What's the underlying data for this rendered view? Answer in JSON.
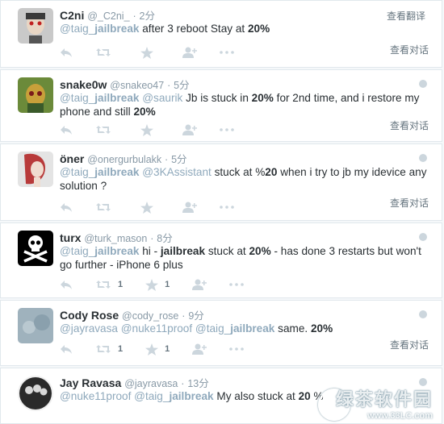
{
  "tweets": [
    {
      "name": "C2ni",
      "handle": "@_C2ni_",
      "sep": "·",
      "time": "2分",
      "translate": "查看翻译",
      "body": [
        {
          "t": "@taig_",
          "c": "mention"
        },
        {
          "t": "jailbreak",
          "c": "mention-b"
        },
        {
          "t": " after 3 reboot Stay at ",
          "c": ""
        },
        {
          "t": "20%",
          "c": "hl"
        }
      ],
      "retweets": "",
      "likes": "",
      "convo": "查看对话"
    },
    {
      "name": "snake0w",
      "handle": "@snakeo47",
      "sep": "·",
      "time": "5分",
      "body": [
        {
          "t": "@taig_",
          "c": "mention"
        },
        {
          "t": "jailbreak",
          "c": "mention-b"
        },
        {
          "t": " @saurik",
          "c": "mention"
        },
        {
          "t": " Jb is stuck in ",
          "c": ""
        },
        {
          "t": "20%",
          "c": "hl"
        },
        {
          "t": " for 2nd time, and i restore my phone and still ",
          "c": ""
        },
        {
          "t": "20%",
          "c": "hl"
        }
      ],
      "retweets": "",
      "likes": "",
      "convo": "查看对话"
    },
    {
      "name": "öner",
      "handle": "@onergurbulakk",
      "sep": "·",
      "time": "5分",
      "body": [
        {
          "t": "@taig_",
          "c": "mention"
        },
        {
          "t": "jailbreak",
          "c": "mention-b"
        },
        {
          "t": " @3KAssistant",
          "c": "mention"
        },
        {
          "t": " stuck at %",
          "c": ""
        },
        {
          "t": "20",
          "c": "hl"
        },
        {
          "t": " when i try to jb my idevice any solution ?",
          "c": ""
        }
      ],
      "retweets": "",
      "likes": "",
      "convo": "查看对话"
    },
    {
      "name": "turx",
      "handle": "@turk_mason",
      "sep": "·",
      "time": "8分",
      "body": [
        {
          "t": "@taig_",
          "c": "mention"
        },
        {
          "t": "jailbreak",
          "c": "mention-b"
        },
        {
          "t": " hi - ",
          "c": ""
        },
        {
          "t": "jailbreak",
          "c": "hl"
        },
        {
          "t": " stuck at ",
          "c": ""
        },
        {
          "t": "20%",
          "c": "hl"
        },
        {
          "t": " - has done 3 restarts but won't go further - iPhone 6 plus",
          "c": ""
        }
      ],
      "retweets": "1",
      "likes": "1",
      "convo": ""
    },
    {
      "name": "Cody Rose",
      "handle": "@cody_rose",
      "sep": "·",
      "time": "9分",
      "body": [
        {
          "t": "@jayravasa",
          "c": "mention"
        },
        {
          "t": " @nuke11proof",
          "c": "mention"
        },
        {
          "t": " @taig_",
          "c": "mention"
        },
        {
          "t": "jailbreak",
          "c": "mention-b"
        },
        {
          "t": " same. ",
          "c": ""
        },
        {
          "t": "20%",
          "c": "hl"
        }
      ],
      "retweets": "1",
      "likes": "1",
      "convo": "查看对话"
    },
    {
      "name": "Jay Ravasa",
      "handle": "@jayravasa",
      "sep": "·",
      "time": "13分",
      "body": [
        {
          "t": "@nuke11proof",
          "c": "mention"
        },
        {
          "t": " @taig_",
          "c": "mention"
        },
        {
          "t": "jailbreak",
          "c": "mention-b"
        },
        {
          "t": " My also stuck at ",
          "c": ""
        },
        {
          "t": "20",
          "c": "hl"
        },
        {
          "t": " %",
          "c": ""
        }
      ],
      "retweets": "",
      "likes": "",
      "convo": ""
    }
  ],
  "watermark": {
    "text": "绿茶软件园",
    "url": "www.33LC.com"
  },
  "colors": {
    "mention": "#8fa9bc",
    "muted": "#8899a6",
    "text": "#292f33"
  }
}
